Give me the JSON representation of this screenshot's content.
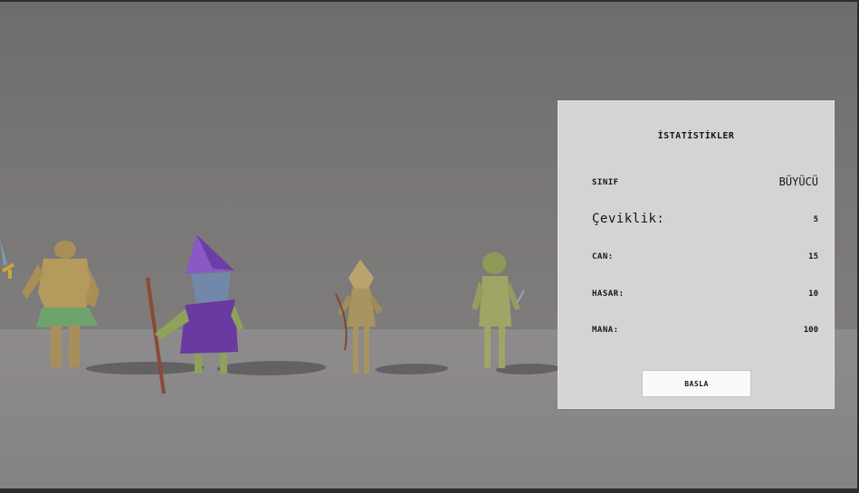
{
  "panel": {
    "title": "İSTATİSTİKLER",
    "stats": [
      {
        "label": "SINIF",
        "value": "BÜYÜCÜ"
      },
      {
        "label": "Çeviklik:",
        "value": "5"
      },
      {
        "label": "CAN:",
        "value": "15"
      },
      {
        "label": "HASAR:",
        "value": "10"
      },
      {
        "label": "MANA:",
        "value": "100"
      }
    ],
    "start_label": "BASLA"
  },
  "colors": {
    "panel_bg": "#d4d4d4",
    "button_bg": "#fafafa",
    "wall": "#7a7777",
    "floor": "#8b8889"
  },
  "characters": [
    "warrior",
    "wizard",
    "archer",
    "rogue"
  ]
}
